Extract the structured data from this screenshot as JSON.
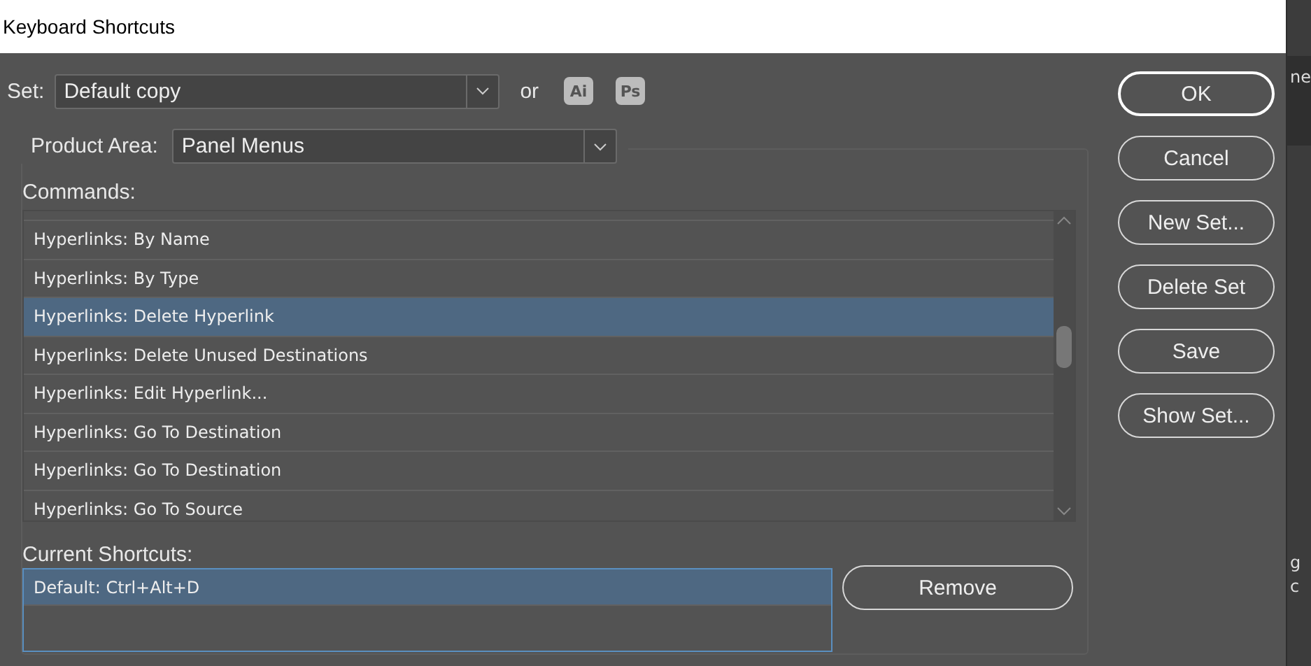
{
  "window": {
    "title": "Keyboard Shortcuts"
  },
  "set": {
    "label": "Set:",
    "value": "Default copy",
    "or": "or",
    "apps": [
      "Ai",
      "Ps"
    ]
  },
  "product_area": {
    "label": "Product Area:",
    "value": "Panel Menus"
  },
  "commands": {
    "label": "Commands:",
    "items": [
      {
        "text": "Hyperlinks: By Name",
        "selected": false
      },
      {
        "text": "Hyperlinks: By Type",
        "selected": false
      },
      {
        "text": "Hyperlinks: Delete Hyperlink",
        "selected": true
      },
      {
        "text": "Hyperlinks: Delete Unused Destinations",
        "selected": false
      },
      {
        "text": "Hyperlinks: Edit Hyperlink...",
        "selected": false
      },
      {
        "text": "Hyperlinks: Go To Destination",
        "selected": false
      },
      {
        "text": "Hyperlinks: Go To Destination",
        "selected": false
      },
      {
        "text": "Hyperlinks: Go To Source",
        "selected": false
      }
    ]
  },
  "current_shortcuts": {
    "label": "Current Shortcuts:",
    "items": [
      {
        "text": "Default: Ctrl+Alt+D",
        "selected": true
      }
    ],
    "remove": "Remove"
  },
  "buttons": [
    {
      "label": "OK",
      "default": true
    },
    {
      "label": "Cancel",
      "default": false
    },
    {
      "label": "New Set...",
      "default": false
    },
    {
      "label": "Delete Set",
      "default": false
    },
    {
      "label": "Save",
      "default": false
    },
    {
      "label": "Show Set...",
      "default": false
    }
  ],
  "background_fragments": [
    "ne",
    "g",
    "c"
  ]
}
